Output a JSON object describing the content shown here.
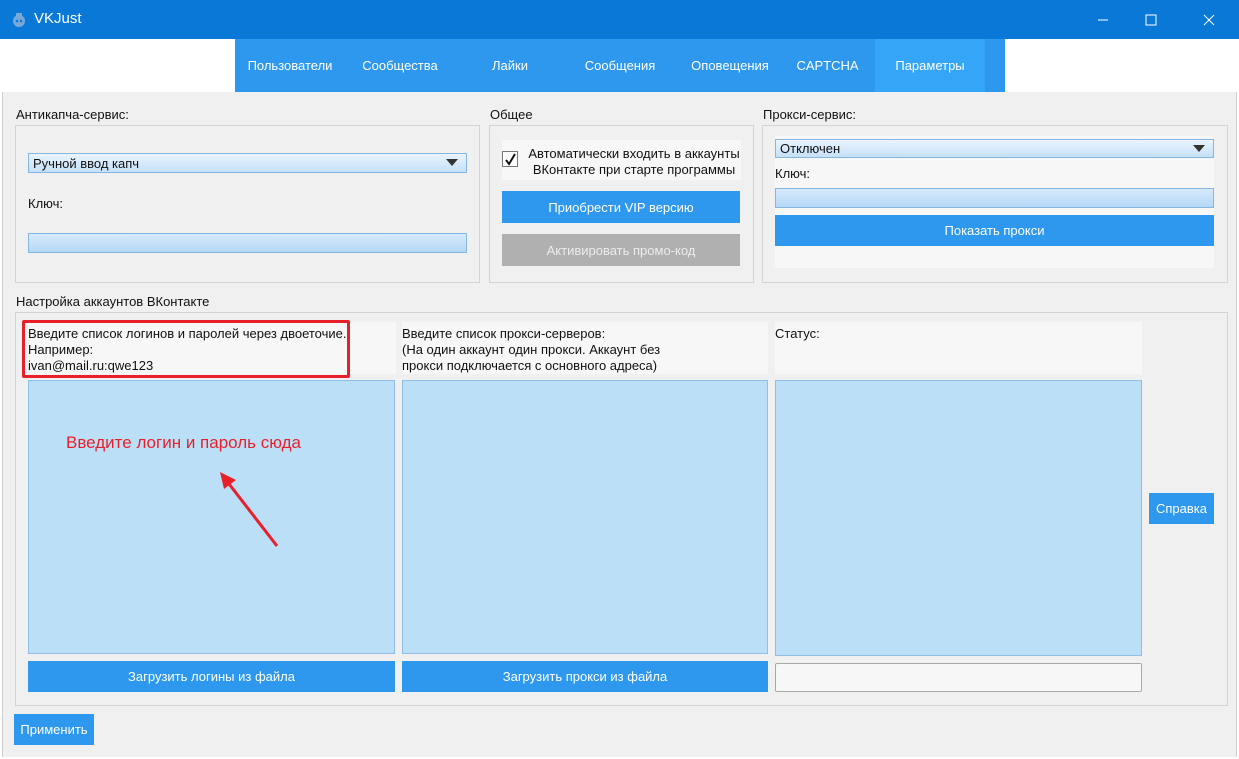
{
  "window": {
    "title": "VKJust"
  },
  "tabs": [
    {
      "label": "Пользователи"
    },
    {
      "label": "Сообщества"
    },
    {
      "label": "Лайки"
    },
    {
      "label": "Сообщения"
    },
    {
      "label": "Оповещения"
    },
    {
      "label": "CAPTCHA"
    },
    {
      "label": "Параметры",
      "active": true
    }
  ],
  "anticaptcha": {
    "title": "Антикапча-сервис:",
    "selected": "Ручной ввод капч",
    "key_label": "Ключ:",
    "key_value": ""
  },
  "general": {
    "title": "Общее",
    "autologin_checked": true,
    "autologin_label": "Автоматически входить в аккаунты\nВКонтакте при старте программы",
    "vip_button": "Приобрести VIP версию",
    "promo_button": "Активировать промо-код"
  },
  "proxy": {
    "title": "Прокси-сервис:",
    "selected": "Отключен",
    "key_label": "Ключ:",
    "key_value": "",
    "show_button": "Показать прокси"
  },
  "accounts": {
    "title": "Настройка аккаунтов ВКонтакте",
    "logins_hint": "Введите список логинов и паролей через двоеточие.\nНапример:\nivan@mail.ru:qwe123",
    "proxies_hint": "Введите список прокси-серверов:\n(На один аккаунт один прокси. Аккаунт без\nпрокси подключается с основного адреса)",
    "status_label": "Статус:",
    "annotation": "Введите логин и пароль сюда",
    "load_logins_button": "Загрузить логины из файла",
    "load_proxies_button": "Загрузить прокси из файла",
    "help_button": "Справка"
  },
  "apply_button": "Применить",
  "colors": {
    "accent": "#2e98ee",
    "titlebar": "#0a78d7",
    "annotation": "#e8202a"
  }
}
